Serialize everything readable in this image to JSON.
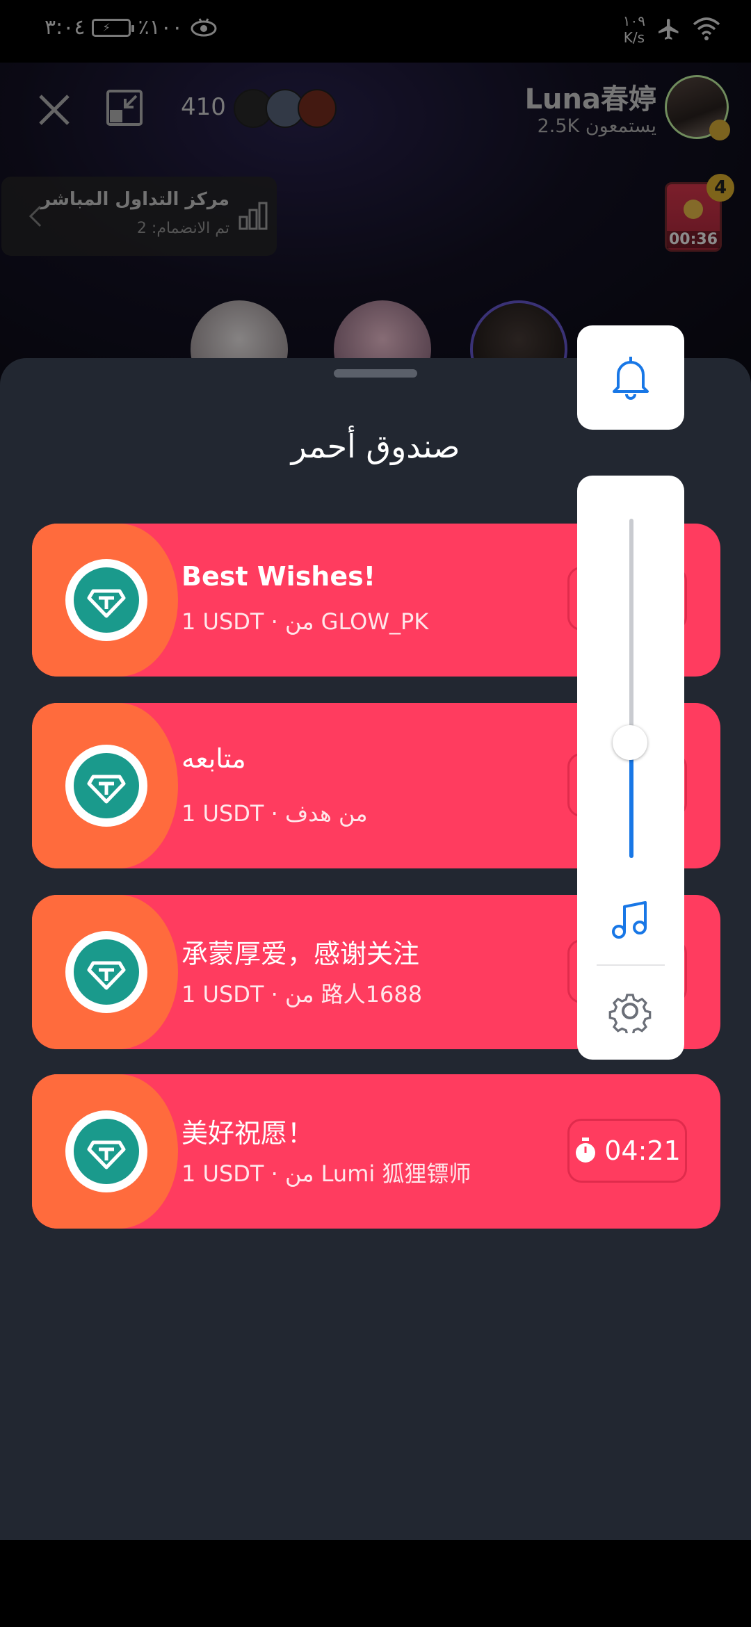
{
  "status_bar": {
    "time": "٣:٠٤",
    "battery": "٪١٠٠",
    "net_speed_value": "١٠٩",
    "net_speed_unit": "K/s"
  },
  "room": {
    "viewer_count": "410",
    "host_name": "Luna春婷",
    "host_listeners": "2.5K يستمعون",
    "trading_center": {
      "title": "مركز التداول المباشر",
      "subtitle": "تم الانضمام: 2"
    },
    "red_packet_widget": {
      "badge": "4",
      "timer": "00:36"
    }
  },
  "sheet": {
    "title": "صندوق أحمر",
    "packets": [
      {
        "title": "Best Wishes!",
        "subtitle": "1 USDT · من GLOW_PK"
      },
      {
        "title": "متابعه",
        "subtitle": "1 USDT · من هدف"
      },
      {
        "title": "承蒙厚爱，感谢关注",
        "subtitle": "1 USDT · من 路人1688"
      },
      {
        "title": "美好祝愿！",
        "subtitle": "1 USDT · من Lumi 狐狸镖师",
        "timer": "04:21"
      }
    ]
  },
  "tool_panel": {
    "volume_level": 0.34,
    "icons": [
      "bell-icon",
      "music-icon",
      "gear-icon"
    ]
  },
  "colors": {
    "packet_red": "#ff3c5f",
    "packet_orange": "#ff6b3d",
    "token_teal": "#1a9a8c",
    "accent_blue": "#1877e6",
    "sheet_bg": "#222731"
  }
}
